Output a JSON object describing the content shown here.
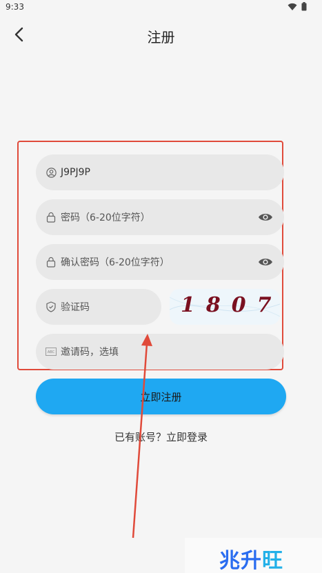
{
  "status_bar": {
    "time": "9:33"
  },
  "header": {
    "title": "注册"
  },
  "form": {
    "username_value": "J9PJ9P",
    "password_placeholder": "密码（6-20位字符）",
    "confirm_placeholder": "确认密码（6-20位字符）",
    "code_placeholder": "验证码",
    "captcha_text": "1807",
    "invite_placeholder": "邀请码，选填",
    "invite_icon_text": "ABC"
  },
  "actions": {
    "register_label": "立即注册",
    "login_link": "已有账号？立即登录"
  },
  "watermark": {
    "text_a": "兆升",
    "text_b": "旺"
  },
  "colors": {
    "accent": "#1fa8f2",
    "highlight": "#e04a3a",
    "captcha": "#7a1020"
  }
}
